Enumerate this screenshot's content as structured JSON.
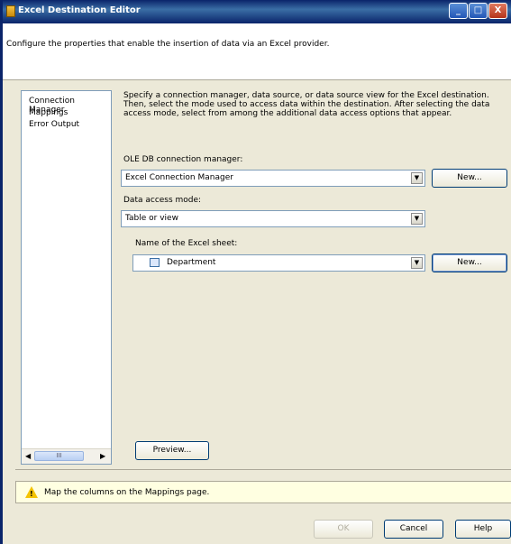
{
  "window": {
    "title": "Excel Destination Editor",
    "description": "Configure the properties that enable the insertion of data via an Excel provider."
  },
  "title_buttons": {
    "minimize": "_",
    "maximize": "□",
    "close": "X"
  },
  "nav": {
    "items": [
      "Connection Manager",
      "Mappings",
      "Error Output"
    ],
    "scroll_thumb": "III"
  },
  "content": {
    "description": "Specify a connection manager, data source, or data source view for the Excel destination. Then, select the mode used to access data within the destination. After selecting the data access mode, select from among the additional data access options that appear.",
    "connection_label": "OLE DB connection manager:",
    "connection_value": "Excel Connection Manager",
    "new_label_1": "New...",
    "access_mode_label": "Data access mode:",
    "access_mode_value": "Table or view",
    "sheet_label": "Name of the Excel sheet:",
    "sheet_value": "Department",
    "new_label_2": "New...",
    "preview_label": "Preview..."
  },
  "info": {
    "message": "Map the columns on the Mappings page."
  },
  "footer": {
    "ok": "OK",
    "cancel": "Cancel",
    "help": "Help"
  },
  "icons": [
    "app-icon",
    "warning-icon",
    "dropdown-arrow-icon",
    "sheet-icon",
    "scroll-left-icon",
    "scroll-right-icon"
  ]
}
